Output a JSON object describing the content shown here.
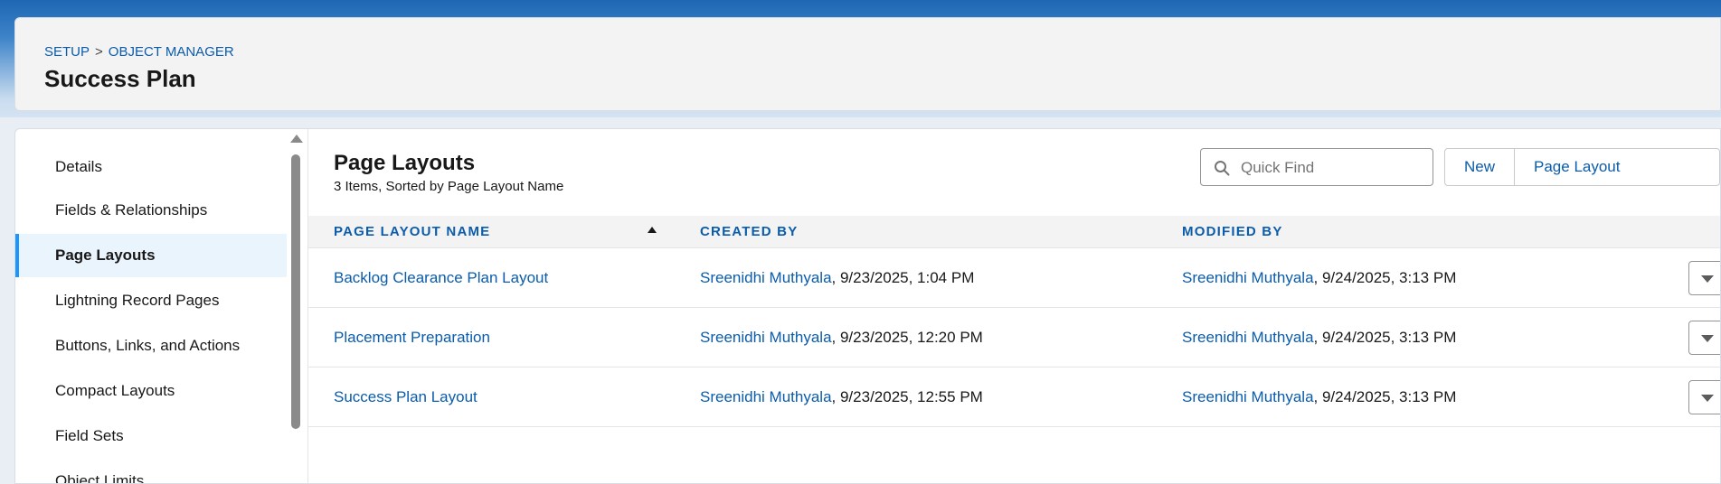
{
  "breadcrumb": {
    "setup": "SETUP",
    "separator": ">",
    "object_manager": "OBJECT MANAGER"
  },
  "page_title": "Success Plan",
  "sidebar": {
    "items": [
      {
        "label": "Details",
        "active": false
      },
      {
        "label": "Fields & Relationships",
        "active": false
      },
      {
        "label": "Page Layouts",
        "active": true
      },
      {
        "label": "Lightning Record Pages",
        "active": false
      },
      {
        "label": "Buttons, Links, and Actions",
        "active": false
      },
      {
        "label": "Compact Layouts",
        "active": false
      },
      {
        "label": "Field Sets",
        "active": false
      },
      {
        "label": "Object Limits",
        "active": false
      }
    ]
  },
  "section": {
    "title": "Page Layouts",
    "subtitle": "3 Items, Sorted by Page Layout Name"
  },
  "search": {
    "placeholder": "Quick Find",
    "value": "",
    "icon": "search-icon"
  },
  "buttons": {
    "new": "New",
    "assignment": "Page Layout Assignment"
  },
  "table": {
    "columns": [
      "PAGE LAYOUT NAME",
      "CREATED BY",
      "MODIFIED BY"
    ],
    "sort": {
      "column": "PAGE LAYOUT NAME",
      "direction": "ascending"
    },
    "rows": [
      {
        "name": "Backlog Clearance Plan Layout",
        "created_user": "Sreenidhi Muthyala",
        "created_date": ", 9/23/2025, 1:04 PM",
        "modified_user": "Sreenidhi Muthyala",
        "modified_date": ", 9/24/2025, 3:13 PM"
      },
      {
        "name": "Placement Preparation",
        "created_user": "Sreenidhi Muthyala",
        "created_date": ", 9/23/2025, 12:20 PM",
        "modified_user": "Sreenidhi Muthyala",
        "modified_date": ", 9/24/2025, 3:13 PM"
      },
      {
        "name": "Success Plan Layout",
        "created_user": "Sreenidhi Muthyala",
        "created_date": ", 9/23/2025, 12:55 PM",
        "modified_user": "Sreenidhi Muthyala",
        "modified_date": ", 9/24/2025, 3:13 PM"
      }
    ]
  },
  "colors": {
    "link": "#0b5cab",
    "active_bar": "#1b96ff",
    "active_bg": "#eaf4fd",
    "brand_band": "#1f67b3"
  }
}
